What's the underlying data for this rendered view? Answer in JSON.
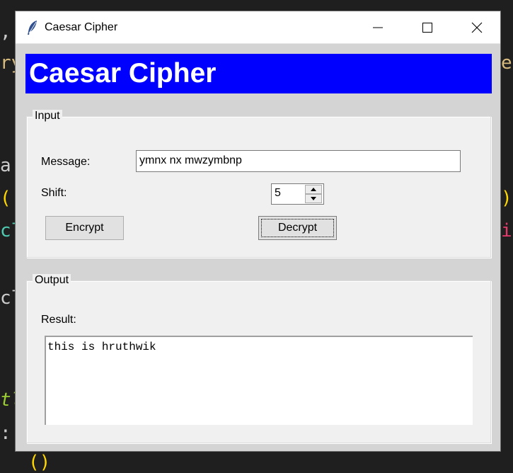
{
  "background_editor": {
    "fragments": [
      ",",
      "ry",
      "e",
      "a",
      "(",
      ")",
      "cl",
      "i",
      "cl",
      "tl",
      ":",
      "()"
    ]
  },
  "window": {
    "title": "Caesar Cipher",
    "icon": "feather-icon",
    "controls": {
      "minimize": "minimize-icon",
      "maximize": "maximize-icon",
      "close": "close-icon"
    }
  },
  "header": {
    "text": "Caesar Cipher",
    "background_color": "#0000ff",
    "text_color": "#ffffff"
  },
  "input_section": {
    "title": "Input",
    "message_label": "Message:",
    "message_value": "ymnx nx mwzymbnp",
    "shift_label": "Shift:",
    "shift_value": "5",
    "encrypt_label": "Encrypt",
    "decrypt_label": "Decrypt"
  },
  "output_section": {
    "title": "Output",
    "result_label": "Result:",
    "result_value": "this is hruthwik"
  }
}
